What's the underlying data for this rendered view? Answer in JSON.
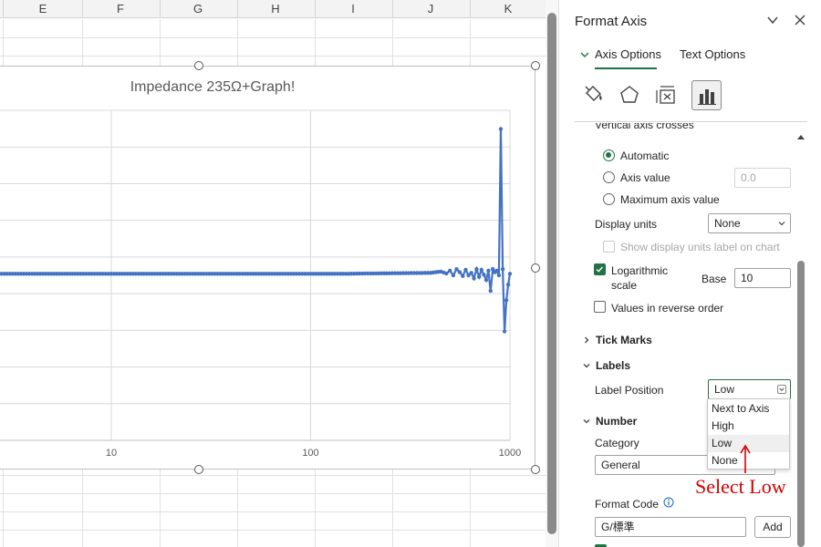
{
  "sheet": {
    "columns": [
      "E",
      "F",
      "G",
      "H",
      "I",
      "J",
      "K"
    ]
  },
  "chart": {
    "title": "Impedance 235Ω+Graph!",
    "x_tick_labels": [
      "10",
      "100",
      "1000"
    ]
  },
  "chart_data": {
    "type": "line",
    "title": "Impedance 235Ω+Graph!",
    "xlabel": "",
    "ylabel": "",
    "x_scale": "log",
    "xlim": [
      1,
      1000
    ],
    "x_ticks": [
      10,
      100,
      1000
    ],
    "grid": true,
    "color": "#4472c4",
    "series": [
      {
        "x": [
          1,
          1.5,
          2,
          3,
          4,
          5,
          7,
          10,
          15,
          20,
          30,
          40,
          50,
          70,
          100,
          150,
          200,
          300,
          400,
          450,
          480,
          500,
          520,
          540,
          560,
          580,
          600,
          620,
          640,
          660,
          680,
          700,
          720,
          740,
          760,
          780,
          800,
          820,
          840,
          860,
          880,
          900,
          920,
          940,
          960,
          980,
          1000
        ],
        "values": [
          235,
          235,
          235,
          235,
          235,
          235,
          235,
          235,
          235,
          235,
          235,
          235,
          235,
          235,
          235,
          235,
          236,
          237,
          238,
          242,
          236,
          245,
          230,
          250,
          240,
          228,
          248,
          230,
          238,
          220,
          250,
          225,
          248,
          232,
          215,
          245,
          180,
          250,
          240,
          245,
          230,
          700,
          250,
          50,
          150,
          200,
          235
        ]
      }
    ]
  },
  "pane": {
    "title": "Format Axis",
    "tabs": {
      "axis_options": "Axis Options",
      "text_options": "Text Options"
    },
    "category_icons": [
      "fill-line-icon",
      "effects-icon",
      "size-properties-icon",
      "axis-options-icon"
    ],
    "vertical_axis_crosses": "Vertical axis crosses",
    "automatic": "Automatic",
    "axis_value": "Axis value",
    "axis_value_input": "0.0",
    "maximum_axis_value": "Maximum axis value",
    "display_units": "Display units",
    "display_units_value": "None",
    "show_display_units": "Show display units label on chart",
    "logarithmic": "Logarithmic",
    "scale": "scale",
    "base": "Base",
    "base_value": "10",
    "values_reverse": "Values in reverse order",
    "tick_marks": "Tick Marks",
    "labels": "Labels",
    "label_position": "Label Position",
    "label_position_value": "Low",
    "label_position_options": [
      "Next to Axis",
      "High",
      "Low",
      "None"
    ],
    "number": "Number",
    "category": "Category",
    "category_value": "General",
    "format_code": "Format Code",
    "format_code_value": "G/標準",
    "add": "Add"
  },
  "annotation": {
    "text": "Select Low",
    "color": "#d00000"
  },
  "colors": {
    "accent": "#217346",
    "series": "#4472c4"
  }
}
